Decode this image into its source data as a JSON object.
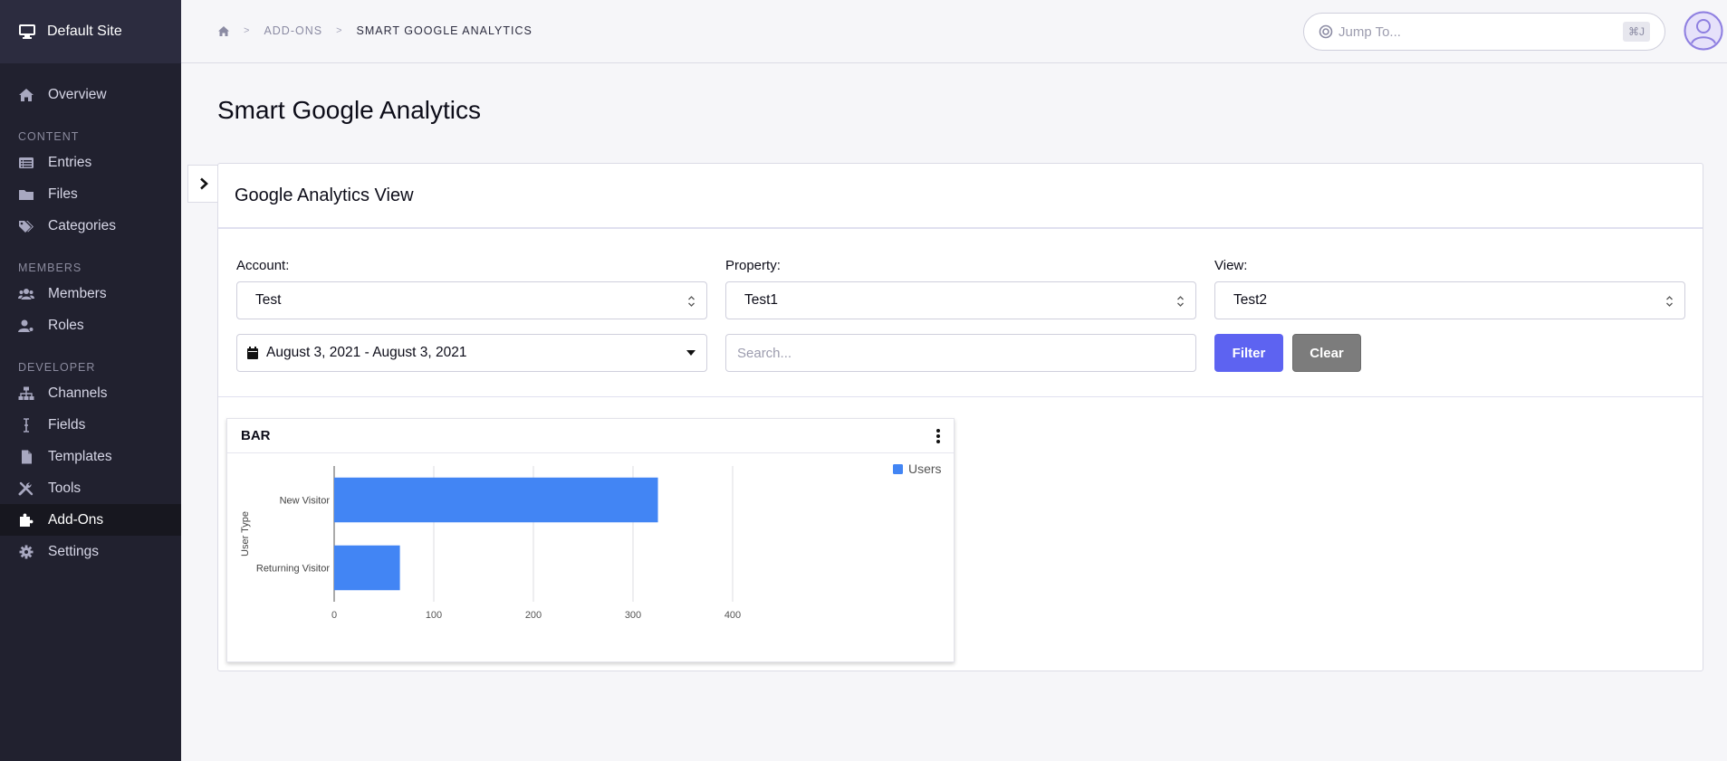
{
  "sidebar": {
    "site_name": "Default Site",
    "items": [
      {
        "label": "Overview",
        "icon": "home-icon"
      },
      {
        "section": "CONTENT"
      },
      {
        "label": "Entries",
        "icon": "list-icon"
      },
      {
        "label": "Files",
        "icon": "folder-icon"
      },
      {
        "label": "Categories",
        "icon": "tags-icon"
      },
      {
        "section": "MEMBERS"
      },
      {
        "label": "Members",
        "icon": "users-icon"
      },
      {
        "label": "Roles",
        "icon": "user-role-icon"
      },
      {
        "section": "DEVELOPER"
      },
      {
        "label": "Channels",
        "icon": "sitemap-icon"
      },
      {
        "label": "Fields",
        "icon": "text-cursor-icon"
      },
      {
        "label": "Templates",
        "icon": "file-icon"
      },
      {
        "label": "Tools",
        "icon": "tools-icon"
      },
      {
        "label": "Add-Ons",
        "icon": "puzzle-icon",
        "active": true
      },
      {
        "label": "Settings",
        "icon": "gear-icon"
      }
    ]
  },
  "topbar": {
    "breadcrumb": [
      "ADD-ONS",
      "SMART GOOGLE ANALYTICS"
    ],
    "breadcrumb_sep": ">",
    "jump_placeholder": "Jump To...",
    "jump_shortcut": "⌘J"
  },
  "page": {
    "title": "Smart Google Analytics",
    "panel_title": "Google Analytics View",
    "account_label": "Account:",
    "account_value": "Test",
    "property_label": "Property:",
    "property_value": "Test1",
    "view_label": "View:",
    "view_value": "Test2",
    "date_range": "August 3, 2021 - August 3, 2021",
    "search_placeholder": "Search...",
    "filter_label": "Filter",
    "clear_label": "Clear"
  },
  "colors": {
    "accent": "#5d63f1",
    "bar": "#4285f4",
    "sidebar_bg": "#21212f"
  },
  "chart_data": {
    "type": "bar",
    "orientation": "horizontal",
    "title": "BAR",
    "categories": [
      "New Visitor",
      "Returning Visitor"
    ],
    "series": [
      {
        "name": "Users",
        "values": [
          325,
          66
        ]
      }
    ],
    "ylabel": "User Type",
    "xlabel": "",
    "xlim": [
      0,
      400
    ],
    "xticks": [
      0,
      100,
      200,
      300,
      400
    ],
    "grid": true,
    "legend": "top-right"
  }
}
